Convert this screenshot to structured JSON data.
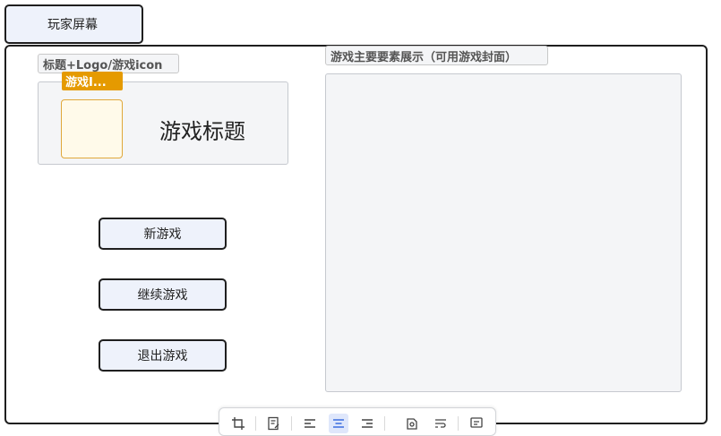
{
  "tab": {
    "label": "玩家屏幕"
  },
  "left_group": {
    "tag": "标题+Logo/游戏icon",
    "icon_tag": "游戏I...",
    "game_title": "游戏标题"
  },
  "right_group": {
    "tag": "游戏主要要素展示（可用游戏封面）"
  },
  "buttons": {
    "new_game": "新游戏",
    "continue_game": "继续游戏",
    "exit_game": "退出游戏"
  },
  "toolbar": {
    "icons": [
      "crop-icon",
      "edit-note-icon",
      "align-left-icon",
      "align-center-icon",
      "align-right-icon",
      "link-edit-icon",
      "text-wrap-icon",
      "comment-icon"
    ],
    "active": "align-center-icon"
  }
}
